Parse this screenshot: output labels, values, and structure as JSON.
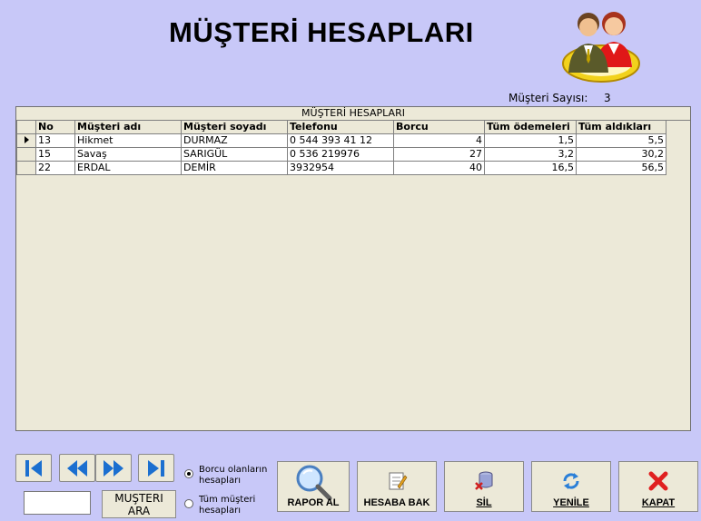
{
  "header": {
    "title": "MÜŞTERİ HESAPLARI",
    "count_label": "Müşteri Sayısı:",
    "count_value": "3"
  },
  "grid": {
    "caption": "MÜŞTERİ HESAPLARI",
    "columns": [
      "No",
      "Müşteri adı",
      "Müşteri soyadı",
      "Telefonu",
      "Borcu",
      "Tüm ödemeleri",
      "Tüm aldıkları"
    ],
    "rows": [
      [
        "13",
        "Hikmet",
        "DURMAZ",
        "0 544 393 41 12",
        "4",
        "1,5",
        "5,5"
      ],
      [
        "15",
        "Savaş",
        "SARIGÜL",
        "0 536 219976",
        "27",
        "3,2",
        "30,2"
      ],
      [
        "22",
        "ERDAL",
        "DEMİR",
        "3932954",
        "40",
        "16,5",
        "56,5"
      ]
    ]
  },
  "navigation": {
    "first_icon": "first-record-icon",
    "prev_icon": "previous-record-icon",
    "next_icon": "next-record-icon",
    "last_icon": "last-record-icon"
  },
  "search": {
    "value": "",
    "button_line1": "MUŞTERI",
    "button_line2": "ARA"
  },
  "filter": {
    "option1_line1": "Borcu olanların",
    "option1_line2": "hesapları",
    "option2_line1": "Tüm müşteri",
    "option2_line2": "hesapları",
    "selected": "option1"
  },
  "actions": {
    "report": "RAPOR AL",
    "view_account": "HESABA BAK",
    "delete": "SİL",
    "refresh": "YENİLE",
    "close": "KAPAT"
  },
  "colors": {
    "background": "#c8c8f8",
    "panel": "#ece9d8",
    "nav_blue": "#1b6fd0"
  }
}
